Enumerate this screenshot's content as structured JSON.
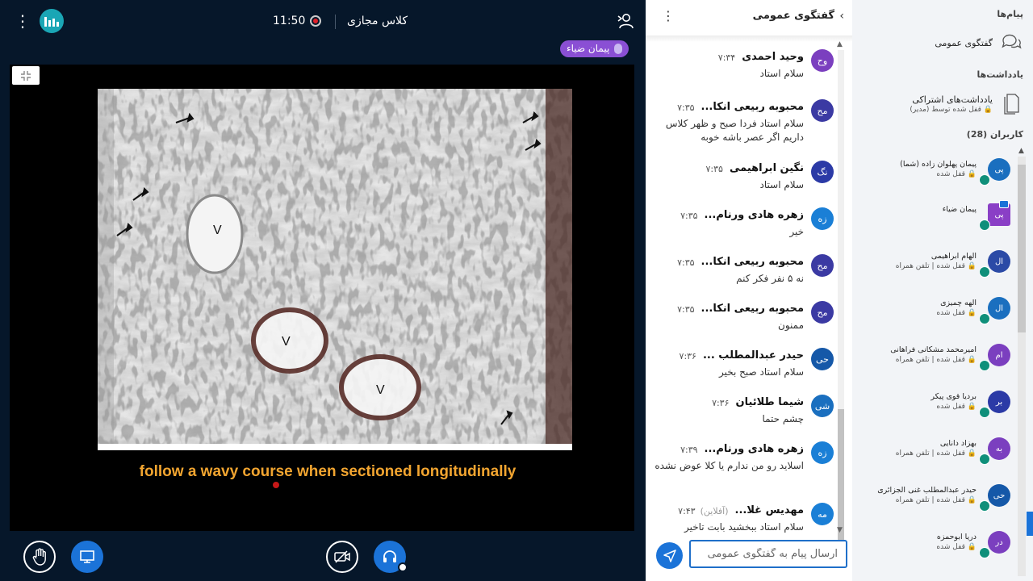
{
  "topbar": {
    "time": "11:50",
    "meeting_title": "کلاس مجازی"
  },
  "presenter_badge": "پیمان ضیاء",
  "slide": {
    "caption": "follow a wavy course when sectioned longitudinally",
    "labels": [
      "V",
      "V",
      "V"
    ]
  },
  "chat": {
    "title": "گفتگوی عمومی",
    "input_placeholder": "ارسال پیام به گفتگوی عمومی",
    "messages": [
      {
        "initials": "وح",
        "color": "#7b3fbf",
        "name": "وحید احمدی",
        "time": "۷:۳۴",
        "text": "سلام استاد",
        "offline": ""
      },
      {
        "initials": "مح",
        "color": "#3b3aa3",
        "name": "محبوبه ربیعی انکا...",
        "time": "۷:۳۵",
        "text": "سلام استاد فردا صبح و ظهر کلاس داریم اگر عصر باشه خوبه",
        "offline": ""
      },
      {
        "initials": "نگ",
        "color": "#2b3aa6",
        "name": "نگین ابراهیمی",
        "time": "۷:۳۵",
        "text": "سلام استاد",
        "offline": ""
      },
      {
        "initials": "زه",
        "color": "#1a7fd6",
        "name": "زهره هادی ورنام...",
        "time": "۷:۳۵",
        "text": "خیر",
        "offline": ""
      },
      {
        "initials": "مح",
        "color": "#3b3aa3",
        "name": "محبوبه ربیعی انکا...",
        "time": "۷:۳۵",
        "text": "نه ۵ نفر فکر کنم",
        "offline": ""
      },
      {
        "initials": "مح",
        "color": "#3b3aa3",
        "name": "محبوبه ربیعی انکا...",
        "time": "۷:۳۵",
        "text": "ممنون",
        "offline": ""
      },
      {
        "initials": "حی",
        "color": "#1558a8",
        "name": "حیدر عبدالمطلب ...",
        "time": "۷:۳۶",
        "text": "سلام استاد صبح بخیر",
        "offline": ""
      },
      {
        "initials": "شی",
        "color": "#1a6fbf",
        "name": "شیما طلائیان",
        "time": "۷:۳۶",
        "text": "چشم حتما",
        "offline": ""
      },
      {
        "initials": "زه",
        "color": "#1a7fd6",
        "name": "زهره هادی ورنام...",
        "time": "۷:۳۹",
        "text": "اسلاید رو من ندارم یا کلا عوض نشده",
        "offline": ""
      },
      {
        "initials": "مه",
        "color": "#1a7fd6",
        "name": "مهدیس غلا...",
        "time": "۷:۴۳",
        "text": "سلام استاد ببخشید بابت تاخیر",
        "offline": "(آفلاین)"
      }
    ]
  },
  "sidebar": {
    "messages_heading": "پیام‌ها",
    "public_chat_label": "گفتگوی عمومی",
    "notes_heading": "یادداشت‌ها",
    "shared_notes_label": "یادداشت‌های اشتراکی",
    "shared_notes_sub": "قفل شده توسط (مدیر)",
    "users_heading": "کاربران (28)",
    "users": [
      {
        "initials": "پی",
        "color": "#1a6fbf",
        "name": "پیمان پهلوان زاده (شما)",
        "status": "قفل شده",
        "square": false,
        "presenter": false
      },
      {
        "initials": "پی",
        "color": "#8a3fc6",
        "name": "پیمان ضیاء",
        "status": "",
        "square": true,
        "presenter": true
      },
      {
        "initials": "ال",
        "color": "#2b4aa6",
        "name": "الهام ابراهیمی",
        "status": "قفل شده | تلفن همراه",
        "square": false,
        "presenter": false
      },
      {
        "initials": "ال",
        "color": "#1a6fbf",
        "name": "الهه چمیزی",
        "status": "قفل شده",
        "square": false,
        "presenter": false
      },
      {
        "initials": "ام",
        "color": "#7b3fbf",
        "name": "امیرمحمد مشکانی فراهانی",
        "status": "قفل شده | تلفن همراه",
        "square": false,
        "presenter": false
      },
      {
        "initials": "بر",
        "color": "#2b3aa6",
        "name": "بردیا قوی پیکر",
        "status": "قفل شده",
        "square": false,
        "presenter": false
      },
      {
        "initials": "به",
        "color": "#7b3fbf",
        "name": "بهزاد دانایی",
        "status": "قفل شده | تلفن همراه",
        "square": false,
        "presenter": false
      },
      {
        "initials": "حی",
        "color": "#1558a8",
        "name": "حیدر عبدالمطلب غنی الجزائری",
        "status": "قفل شده | تلفن همراه",
        "square": false,
        "presenter": false
      },
      {
        "initials": "در",
        "color": "#7b3fbf",
        "name": "دریا ابوحمزه",
        "status": "قفل شده",
        "square": false,
        "presenter": false
      }
    ]
  }
}
